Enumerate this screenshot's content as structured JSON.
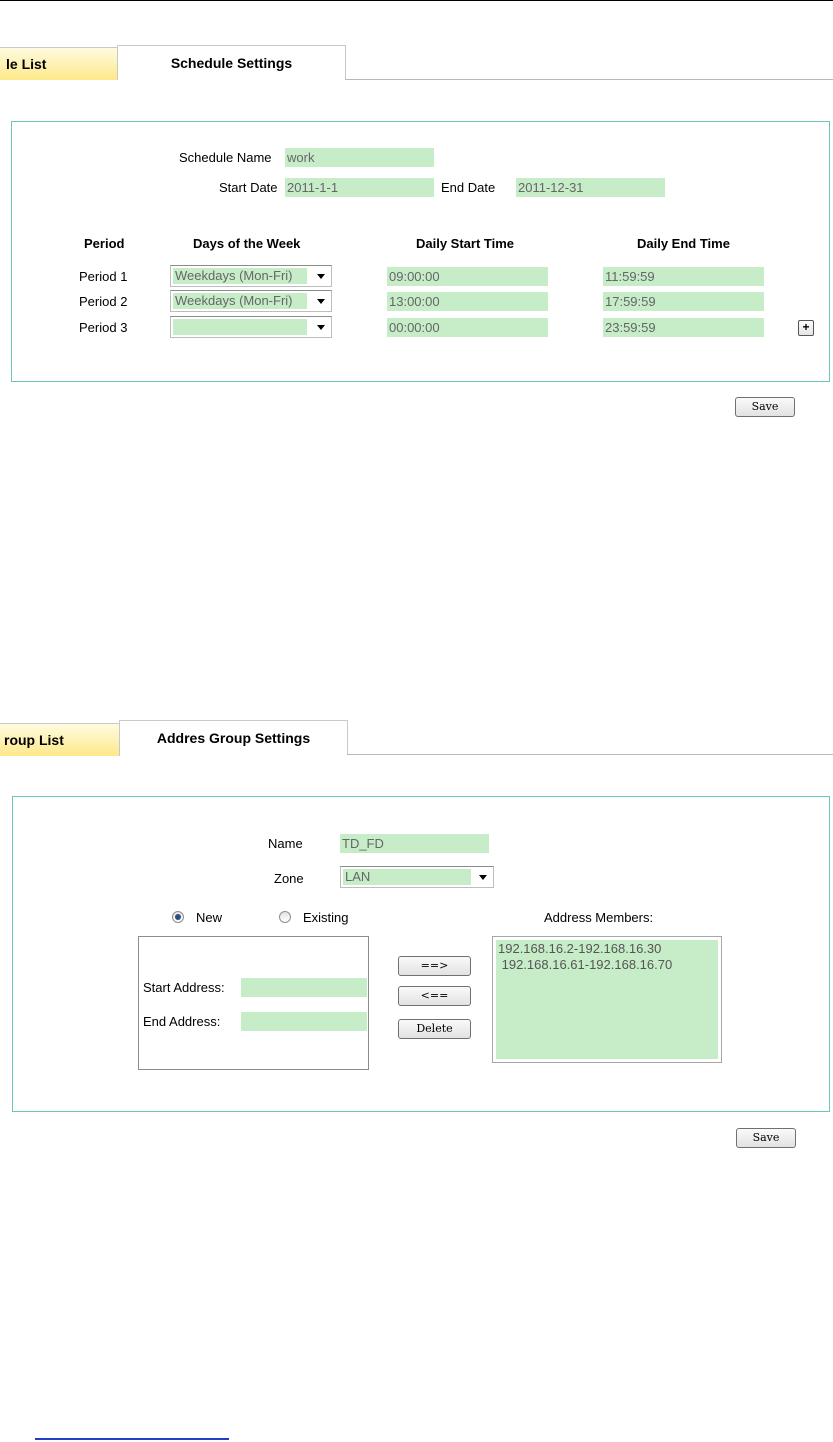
{
  "schedule": {
    "tabs": {
      "list_label": "le List",
      "settings_label": "Schedule Settings"
    },
    "name_label": "Schedule Name",
    "name_value": "work",
    "start_date_label": "Start Date",
    "start_date_value": "2011-1-1",
    "end_date_label": "End Date",
    "end_date_value": "2011-12-31",
    "headers": {
      "period": "Period",
      "days": "Days of the Week",
      "start": "Daily Start Time",
      "end": "Daily End Time"
    },
    "periods": [
      {
        "label": "Period 1",
        "days": "Weekdays (Mon-Fri)",
        "start": "09:00:00",
        "end": "11:59:59"
      },
      {
        "label": "Period 2",
        "days": "Weekdays (Mon-Fri)",
        "start": "13:00:00",
        "end": "17:59:59"
      },
      {
        "label": "Period 3",
        "days": "",
        "start": "00:00:00",
        "end": "23:59:59"
      }
    ],
    "add_label": "+",
    "save_label": "Save"
  },
  "group": {
    "tabs": {
      "list_label": "roup List",
      "settings_label": "Addres Group Settings"
    },
    "name_label": "Name",
    "name_value": "TD_FD",
    "zone_label": "Zone",
    "zone_value": "LAN",
    "new_label": "New",
    "existing_label": "Existing",
    "new_selected": true,
    "members_label": "Address Members:",
    "start_address_label": "Start Address:",
    "end_address_label": "End Address:",
    "add_btn": "==>",
    "remove_btn": "<==",
    "delete_btn": "Delete",
    "members": [
      "192.168.16.2-192.168.16.30",
      " 192.168.16.61-192.168.16.70"
    ],
    "save_label": "Save"
  },
  "colors": {
    "panel_border": "#6cc7b9",
    "field_bg": "#c6ecc8",
    "tab_yellow": "#fde98a",
    "link_blue": "#1f3fc6"
  }
}
